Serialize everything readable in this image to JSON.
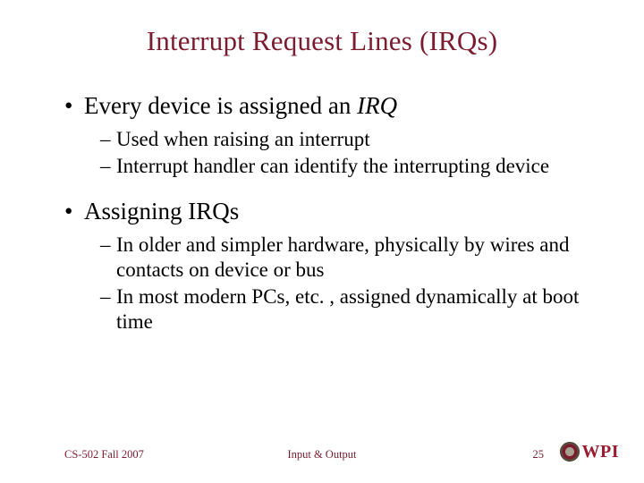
{
  "title": "Interrupt Request Lines (IRQs)",
  "bullets": [
    {
      "text_pre": "Every device is assigned an ",
      "text_em": "IRQ",
      "sub": [
        "Used when raising an interrupt",
        "Interrupt handler can identify the interrupting device"
      ]
    },
    {
      "text_pre": "Assigning IRQs",
      "text_em": "",
      "sub": [
        "In older and simpler hardware, physically by wires and contacts on device or bus",
        "In most modern PCs, etc. , assigned dynamically at boot time"
      ]
    }
  ],
  "footer": {
    "left": "CS-502 Fall 2007",
    "center": "Input & Output",
    "page": "25",
    "logo_text": "WPI"
  },
  "colors": {
    "brand": "#7a1b2e",
    "logo_red": "#9a1c31"
  }
}
